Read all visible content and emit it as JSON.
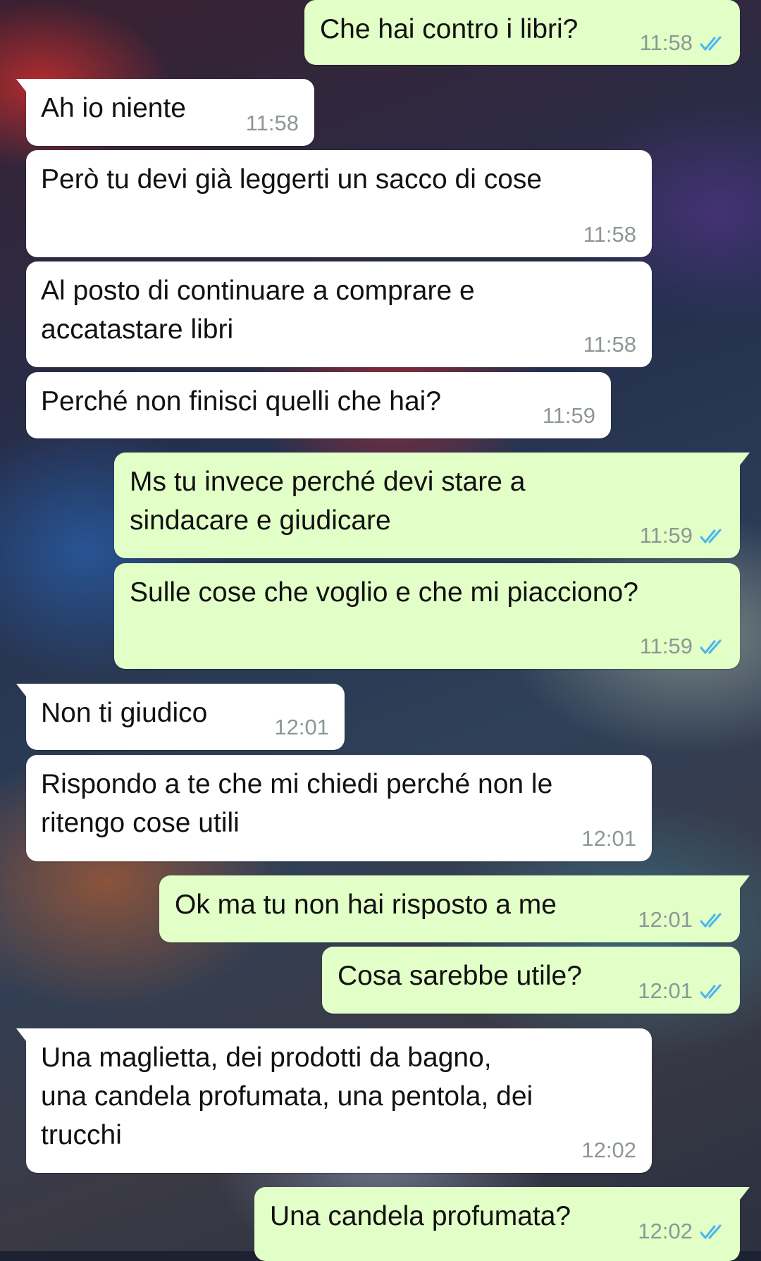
{
  "colors": {
    "incoming_bubble": "#ffffff",
    "outgoing_bubble": "#e2ffc7",
    "timestamp": "#8d9796",
    "read_ticks": "#4fb6ec"
  },
  "messages": [
    {
      "direction": "out",
      "lines": [
        "Che hai contro i libri?"
      ],
      "time": "11:58",
      "status": "read-ticks-icon"
    },
    {
      "direction": "in",
      "lines": [
        "Ah io niente"
      ],
      "time": "11:58"
    },
    {
      "direction": "in",
      "lines": [
        "Però tu devi già leggerti un sacco di cose"
      ],
      "time": "11:58"
    },
    {
      "direction": "in",
      "lines": [
        "Al posto di continuare a comprare e",
        "accatastare libri"
      ],
      "time": "11:58"
    },
    {
      "direction": "in",
      "lines": [
        "Perché non finisci quelli che hai?"
      ],
      "time": "11:59"
    },
    {
      "direction": "out",
      "lines": [
        "Ms tu invece perché devi stare a",
        "sindacare e giudicare"
      ],
      "time": "11:59",
      "status": "read-ticks-icon"
    },
    {
      "direction": "out",
      "lines": [
        "Sulle cose che voglio e che mi piacciono?"
      ],
      "time": "11:59",
      "status": "read-ticks-icon"
    },
    {
      "direction": "in",
      "lines": [
        "Non ti giudico"
      ],
      "time": "12:01"
    },
    {
      "direction": "in",
      "lines": [
        "Rispondo a te che mi chiedi perché non le",
        "ritengo cose utili"
      ],
      "time": "12:01"
    },
    {
      "direction": "out",
      "lines": [
        "Ok ma tu non hai risposto a me"
      ],
      "time": "12:01",
      "status": "read-ticks-icon"
    },
    {
      "direction": "out",
      "lines": [
        "Cosa sarebbe utile?"
      ],
      "time": "12:01",
      "status": "read-ticks-icon"
    },
    {
      "direction": "in",
      "lines": [
        "Una maglietta, dei prodotti da bagno,",
        "una candela profumata, una pentola, dei",
        "trucchi"
      ],
      "time": "12:02"
    },
    {
      "direction": "out",
      "lines": [
        "Una candela profumata?"
      ],
      "time": "12:02",
      "status": "read-ticks-icon"
    }
  ]
}
